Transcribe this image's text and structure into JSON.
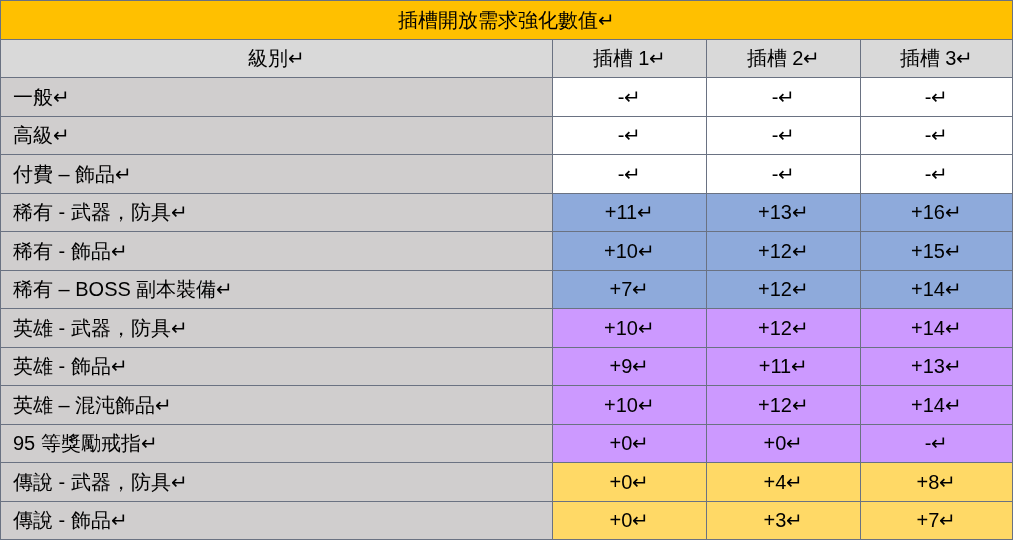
{
  "title": "插槽開放需求強化數值↵",
  "columns": [
    "級別↵",
    "插槽 1↵",
    "插槽 2↵",
    "插槽 3↵"
  ],
  "rows": [
    {
      "label": "一般↵",
      "color": "#ffffff",
      "values": [
        "-↵",
        "-↵",
        "-↵"
      ]
    },
    {
      "label": "高級↵",
      "color": "#ffffff",
      "values": [
        "-↵",
        "-↵",
        "-↵"
      ]
    },
    {
      "label": "付費 – 飾品↵",
      "color": "#ffffff",
      "values": [
        "-↵",
        "-↵",
        "-↵"
      ]
    },
    {
      "label": "稀有 - 武器，防具↵",
      "color": "#8eaadb",
      "values": [
        "+11↵",
        "+13↵",
        "+16↵"
      ]
    },
    {
      "label": "稀有 - 飾品↵",
      "color": "#8eaadb",
      "values": [
        "+10↵",
        "+12↵",
        "+15↵"
      ]
    },
    {
      "label": "稀有 – BOSS 副本裝備↵",
      "color": "#8eaadb",
      "values": [
        "+7↵",
        "+12↵",
        "+14↵"
      ]
    },
    {
      "label": "英雄 - 武器，防具↵",
      "color": "#cc99ff",
      "values": [
        "+10↵",
        "+12↵",
        "+14↵"
      ]
    },
    {
      "label": "英雄 - 飾品↵",
      "color": "#cc99ff",
      "values": [
        "+9↵",
        "+11↵",
        "+13↵"
      ]
    },
    {
      "label": "英雄 – 混沌飾品↵",
      "color": "#cc99ff",
      "values": [
        "+10↵",
        "+12↵",
        "+14↵"
      ]
    },
    {
      "label": "95 等獎勵戒指↵",
      "color": "#cc99ff",
      "values": [
        "+0↵",
        "+0↵",
        "-↵"
      ]
    },
    {
      "label": "傳說 - 武器，防具↵",
      "color": "#ffd966",
      "values": [
        "+0↵",
        "+4↵",
        "+8↵"
      ]
    },
    {
      "label": "傳說 - 飾品↵",
      "color": "#ffd966",
      "values": [
        "+0↵",
        "+3↵",
        "+7↵"
      ]
    }
  ]
}
